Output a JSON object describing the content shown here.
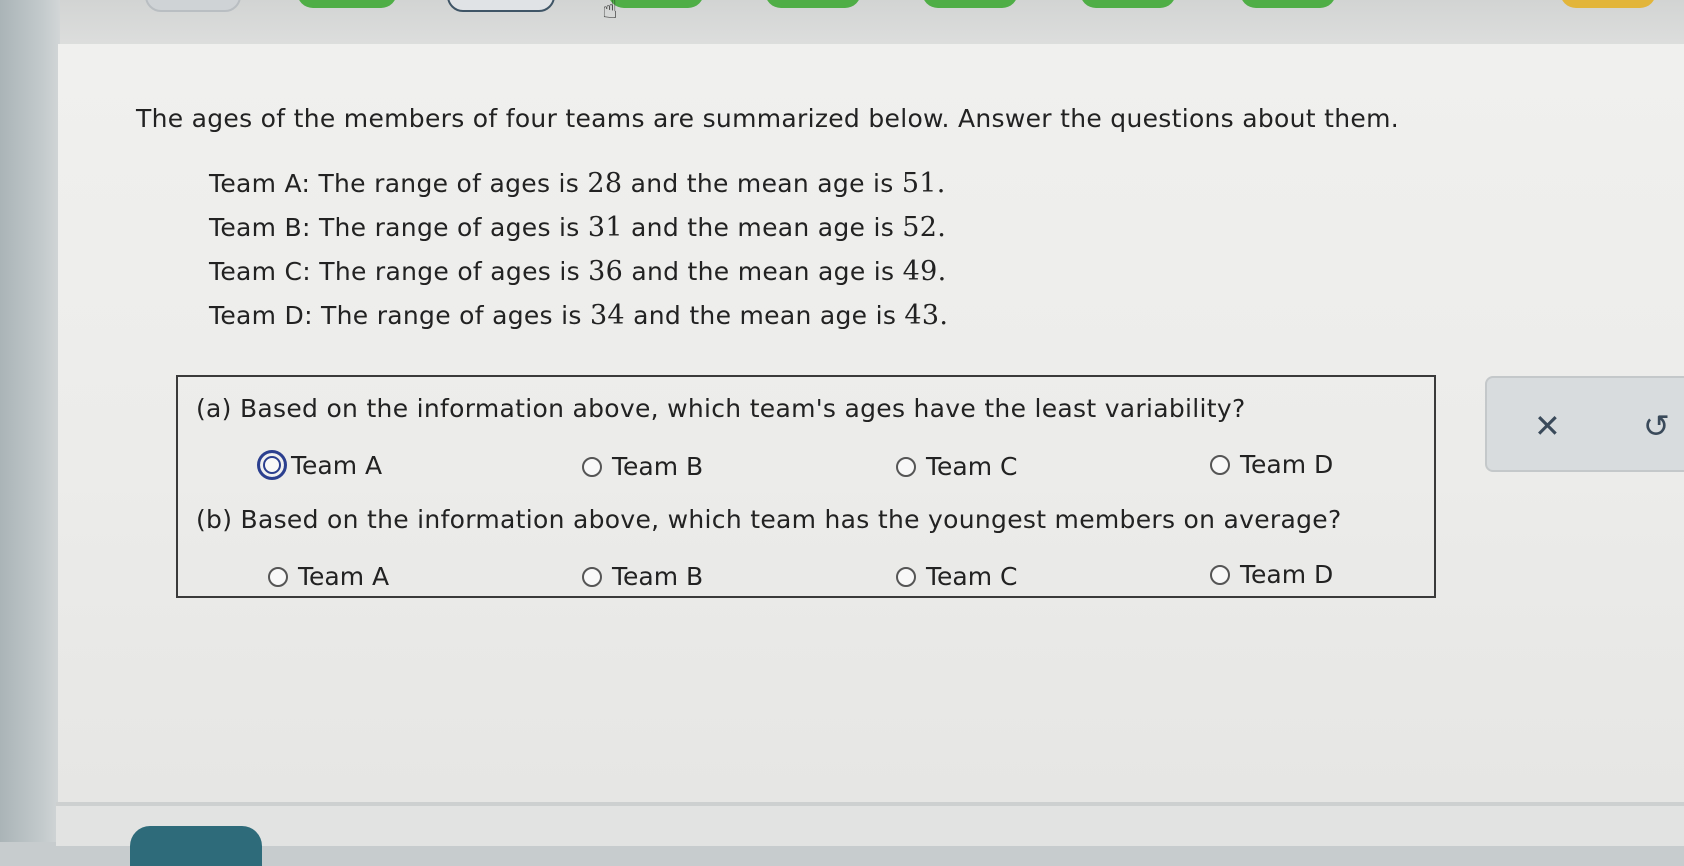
{
  "intro_text": "The ages of the members of four teams are summarized below. Answer the questions about them.",
  "teams": [
    {
      "label": "Team A",
      "text_range": ": The range of ages is ",
      "range": "28",
      "text_mean": " and the mean age is ",
      "mean": "51",
      "end": "."
    },
    {
      "label": "Team B",
      "text_range": ": The range of ages is ",
      "range": "31",
      "text_mean": " and the mean age is ",
      "mean": "52",
      "end": "."
    },
    {
      "label": "Team C",
      "text_range": ": The range of ages is ",
      "range": "36",
      "text_mean": " and the mean age is ",
      "mean": "49",
      "end": "."
    },
    {
      "label": "Team D",
      "text_range": ": The range of ages is ",
      "range": "34",
      "text_mean": " and the mean age is ",
      "mean": "43",
      "end": "."
    }
  ],
  "questions": [
    {
      "text": "(a) Based on the information above, which team's ages have the least variability?",
      "options": [
        "Team A",
        "Team B",
        "Team C",
        "Team D"
      ],
      "focused_option": "Team A"
    },
    {
      "text": "(b) Based on the information above, which team has the youngest members on average?",
      "options": [
        "Team A",
        "Team B",
        "Team C",
        "Team D"
      ],
      "focused_option": ""
    }
  ],
  "actions": {
    "clear_icon": "close-icon",
    "clear_glyph": "✕",
    "undo_icon": "undo-icon",
    "undo_glyph": "↺"
  },
  "colors": {
    "focus_ring": "#2b3f8f",
    "tab_green": "#4fae46",
    "bottom_button": "#2e6b7a"
  }
}
